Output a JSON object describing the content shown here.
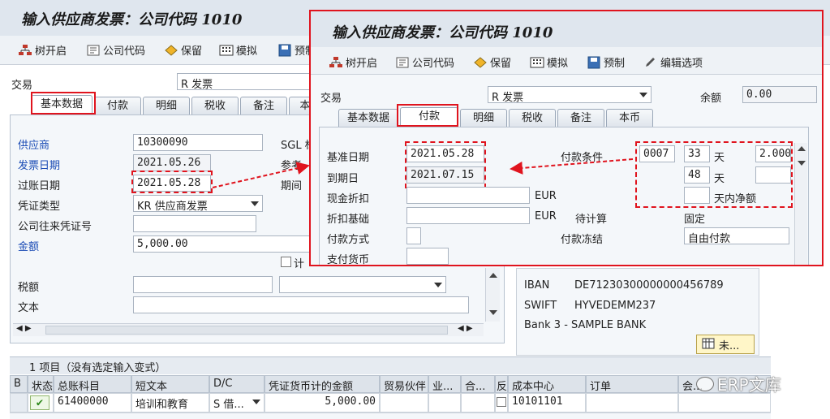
{
  "main": {
    "title": "输入供应商发票：公司代码 1010",
    "toolbar": {
      "tree": "树开启",
      "company_code": "公司代码",
      "hold": "保留",
      "simulate": "模拟",
      "park": "预制"
    },
    "transaction_label": "交易",
    "transaction_value": "R 发票",
    "tabs": [
      "基本数据",
      "付款",
      "明细",
      "税收",
      "备注",
      "本"
    ],
    "fields": {
      "vendor_label": "供应商",
      "vendor_value": "10300090",
      "invoice_date_label": "发票日期",
      "invoice_date_value": "2021.05.26",
      "posting_date_label": "过账日期",
      "posting_date_value": "2021.05.28",
      "doc_type_label": "凭证类型",
      "doc_type_value": "KR 供应商发票",
      "cross_cc_label": "公司往来凭证号",
      "amount_label": "金额",
      "amount_value": "5,000.00",
      "sgl_label": "SGL 标",
      "ref_label": "参考",
      "period_label": "期间",
      "calc_tax_label": "计",
      "tax_label": "税额",
      "text_label": "文本"
    },
    "vendor_info": {
      "iban_label": "IBAN",
      "iban_value": "DE71230300000000456789",
      "swift_label": "SWIFT",
      "swift_value": "HYVEDEMM237",
      "bank": "Bank 3 - SAMPLE BANK",
      "more_button": "未..."
    },
    "items_bar": "1 项目（没有选定输入变式）",
    "grid": {
      "headers": [
        "B",
        "状态",
        "总账科目",
        "短文本",
        "D/C",
        "凭证货币计的金额",
        "贸易伙伴",
        "业...",
        "合...",
        "反",
        "成本中心",
        "订单",
        "会..."
      ],
      "row": {
        "gl": "61400000",
        "text": "培训和教育",
        "dc": "S 借...",
        "amount": "5,000.00",
        "cost_center": "10101101"
      }
    }
  },
  "popup": {
    "title": "输入供应商发票：公司代码 1010",
    "toolbar": {
      "tree": "树开启",
      "company_code": "公司代码",
      "hold": "保留",
      "simulate": "模拟",
      "park": "预制",
      "edit_options": "编辑选项"
    },
    "transaction_label": "交易",
    "transaction_value": "R 发票",
    "balance_label": "余额",
    "balance_value": "0.00",
    "tabs": [
      "基本数据",
      "付款",
      "明细",
      "税收",
      "备注",
      "本币"
    ],
    "fields": {
      "baseline_date_label": "基准日期",
      "baseline_date_value": "2021.05.28",
      "due_date_label": "到期日",
      "due_date_value": "2021.07.15",
      "cash_discount_label": "现金折扣",
      "eur1": "EUR",
      "discount_base_label": "折扣基础",
      "eur2": "EUR",
      "payment_method_label": "付款方式",
      "payment_currency_label": "支付货币",
      "payment_terms_label": "付款条件",
      "terms_code": "0007",
      "days1": "33",
      "day_unit1": "天",
      "pct1": "2.000",
      "days2": "48",
      "day_unit2": "天",
      "net_label": "天内净额",
      "pending_calc_label": "待计算",
      "fixed_label": "固定",
      "payment_block_label": "付款冻结",
      "payment_block_value": "自由付款"
    }
  },
  "watermark": "ERP文库"
}
